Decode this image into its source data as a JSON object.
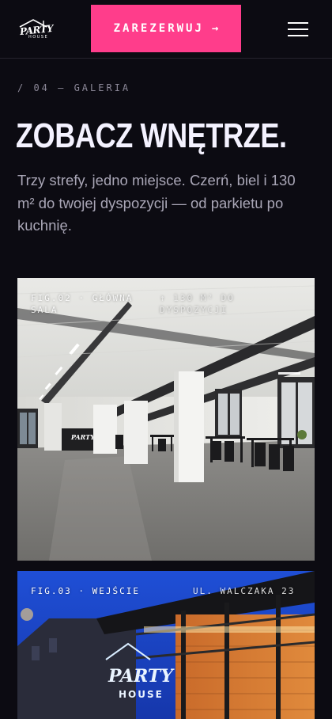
{
  "header": {
    "logo_text": "PARTY",
    "logo_subtext": "HOUSE",
    "cta_label": "ZAREZERWUJ",
    "cta_arrow": "→",
    "menu_icon": "hamburger-menu-icon"
  },
  "section": {
    "eyebrow": "/ 04 — GALERIA",
    "title": "ZOBACZ WNĘTRZE.",
    "lead": "Trzy strefy, jedno miejsce. Czerń, biel i 130 m² do twojej dyspozycji — od parkietu po kuchnię."
  },
  "figures": [
    {
      "caption_left": "FIG.02 · GŁÓWNA SALA",
      "caption_right": "↑ 130 M² DO DYSPOZYCJI",
      "sign_text": "PARTY"
    },
    {
      "caption_left": "FIG.03 · WEJŚCIE",
      "caption_right": "UL. WALCZAKA 23",
      "sign_text": "PARTY",
      "sign_subtext": "HOUSE"
    }
  ],
  "colors": {
    "background": "#0c0b12",
    "accent": "#ff3d8b",
    "title": "#f4f2ff",
    "muted": "#8c8898"
  }
}
